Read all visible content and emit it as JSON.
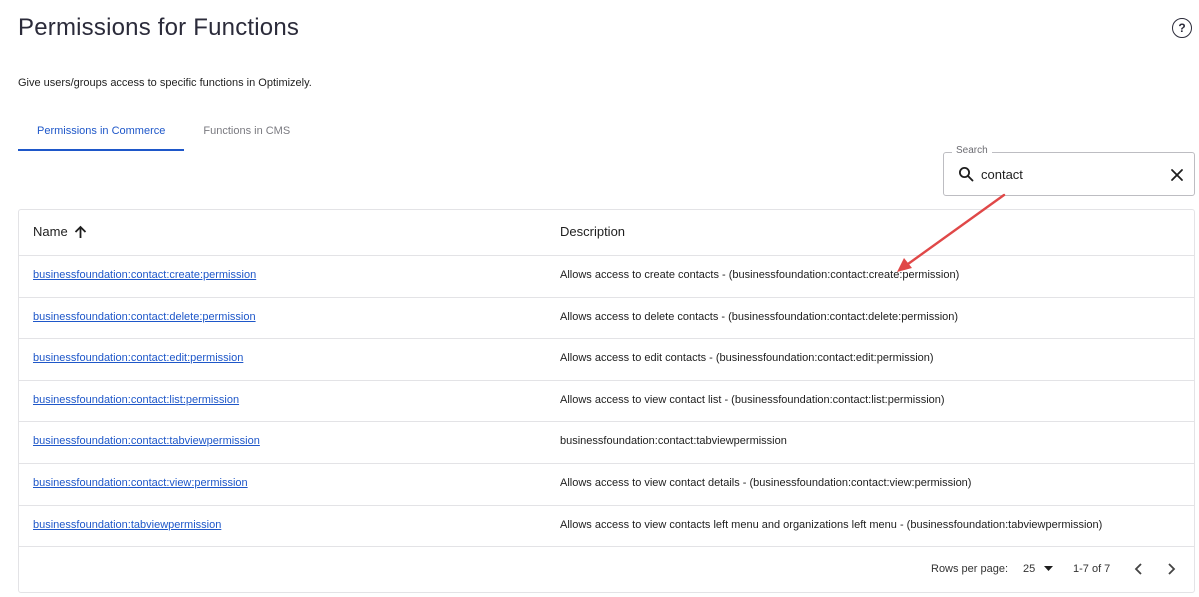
{
  "header": {
    "title": "Permissions for Functions",
    "subtitle": "Give users/groups access to specific functions in Optimizely.",
    "help_icon": "help-circle-icon"
  },
  "tabs": [
    {
      "label": "Permissions in Commerce",
      "active": true
    },
    {
      "label": "Functions in CMS",
      "active": false
    }
  ],
  "search": {
    "label": "Search",
    "value": "contact",
    "placeholder": ""
  },
  "table": {
    "columns": {
      "name": "Name",
      "description": "Description"
    },
    "sort": {
      "column": "Name",
      "direction": "ascending"
    },
    "rows": [
      {
        "name": "businessfoundation:contact:create:permission",
        "description": "Allows access to create contacts - (businessfoundation:contact:create:permission)"
      },
      {
        "name": "businessfoundation:contact:delete:permission",
        "description": "Allows access to delete contacts - (businessfoundation:contact:delete:permission)"
      },
      {
        "name": "businessfoundation:contact:edit:permission",
        "description": "Allows access to edit contacts - (businessfoundation:contact:edit:permission)"
      },
      {
        "name": "businessfoundation:contact:list:permission",
        "description": "Allows access to view contact list - (businessfoundation:contact:list:permission)"
      },
      {
        "name": "businessfoundation:contact:tabviewpermission",
        "description": "businessfoundation:contact:tabviewpermission"
      },
      {
        "name": "businessfoundation:contact:view:permission",
        "description": "Allows access to view contact details - (businessfoundation:contact:view:permission)"
      },
      {
        "name": "businessfoundation:tabviewpermission",
        "description": "Allows access to view contacts left menu and organizations left menu - (businessfoundation:tabviewpermission)"
      }
    ]
  },
  "pagination": {
    "rows_per_page_label": "Rows per page:",
    "rows_per_page": "25",
    "range": "1-7 of 7"
  },
  "colors": {
    "accent": "#1e57c9",
    "annotation": "#e04848"
  }
}
